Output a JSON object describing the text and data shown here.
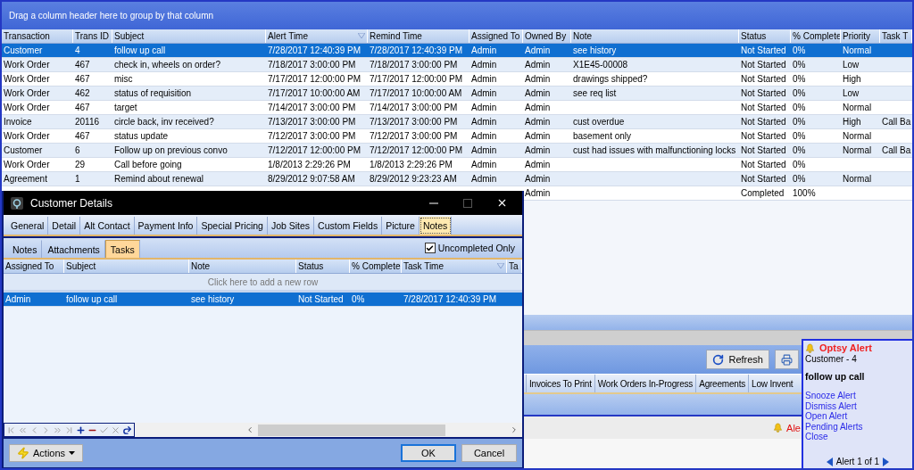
{
  "group_panel": {
    "hint": "Drag a column header here to group by that column"
  },
  "grid": {
    "columns": [
      {
        "label": "Transaction",
        "sorted": false
      },
      {
        "label": "Trans ID",
        "sorted": false
      },
      {
        "label": "Subject",
        "sorted": false
      },
      {
        "label": "Alert Time",
        "sorted": true
      },
      {
        "label": "Remind Time",
        "sorted": false
      },
      {
        "label": "Assigned To",
        "sorted": false
      },
      {
        "label": "Owned By",
        "sorted": false
      },
      {
        "label": "Note",
        "sorted": false
      },
      {
        "label": "Status",
        "sorted": false
      },
      {
        "label": "% Complete",
        "sorted": false
      },
      {
        "label": "Priority",
        "sorted": false
      },
      {
        "label": "Task T",
        "sorted": false
      }
    ],
    "rows": [
      {
        "selected": true,
        "cells": [
          "Customer",
          "4",
          "follow up call",
          "7/28/2017 12:40:39 PM",
          "7/28/2017 12:40:39 PM",
          "Admin",
          "Admin",
          "see history",
          "Not Started",
          "0%",
          "Normal",
          null
        ]
      },
      {
        "selected": false,
        "cells": [
          "Work Order",
          "467",
          "check in, wheels on order?",
          "7/18/2017 3:00:00 PM",
          "7/18/2017 3:00:00 PM",
          "Admin",
          "Admin",
          "X1E45-00008",
          "Not Started",
          "0%",
          "Low",
          null
        ]
      },
      {
        "selected": false,
        "cells": [
          "Work Order",
          "467",
          "misc",
          "7/17/2017 12:00:00 PM",
          "7/17/2017 12:00:00 PM",
          "Admin",
          "Admin",
          "drawings shipped?",
          "Not Started",
          "0%",
          "High",
          null
        ]
      },
      {
        "selected": false,
        "cells": [
          "Work Order",
          "462",
          "status of requisition",
          "7/17/2017 10:00:00 AM",
          "7/17/2017 10:00:00 AM",
          "Admin",
          "Admin",
          "see req list",
          "Not Started",
          "0%",
          "Low",
          null
        ]
      },
      {
        "selected": false,
        "cells": [
          "Work Order",
          "467",
          "target",
          "7/14/2017 3:00:00 PM",
          "7/14/2017 3:00:00 PM",
          "Admin",
          "Admin",
          null,
          "Not Started",
          "0%",
          "Normal",
          null
        ]
      },
      {
        "selected": false,
        "cells": [
          "Invoice",
          "20116",
          "circle back, inv received?",
          "7/13/2017 3:00:00 PM",
          "7/13/2017 3:00:00 PM",
          "Admin",
          "Admin",
          "cust overdue",
          "Not Started",
          "0%",
          "High",
          "Call Ba"
        ]
      },
      {
        "selected": false,
        "cells": [
          "Work Order",
          "467",
          "status update",
          "7/12/2017 3:00:00 PM",
          "7/12/2017 3:00:00 PM",
          "Admin",
          "Admin",
          "basement only",
          "Not Started",
          "0%",
          "Normal",
          null
        ]
      },
      {
        "selected": false,
        "cells": [
          "Customer",
          "6",
          "Follow up on previous convo",
          "7/12/2017 12:00:00 PM",
          "7/12/2017 12:00:00 PM",
          "Admin",
          "Admin",
          "cust had issues with malfunctioning locks",
          "Not Started",
          "0%",
          "Normal",
          "Call Ba"
        ]
      },
      {
        "selected": false,
        "cells": [
          "Work Order",
          "29",
          "Call before going",
          "1/8/2013 2:29:26 PM",
          "1/8/2013 2:29:26 PM",
          "Admin",
          "Admin",
          null,
          "Not Started",
          "0%",
          null,
          null
        ]
      },
      {
        "selected": false,
        "cells": [
          "Agreement",
          "1",
          "Remind about renewal",
          "8/29/2012 9:07:58 AM",
          "8/29/2012 9:23:23 AM",
          "Admin",
          "Admin",
          null,
          "Not Started",
          "0%",
          "Normal",
          null
        ]
      },
      {
        "selected": false,
        "cells": [
          null,
          null,
          null,
          null,
          null,
          null,
          "Admin",
          null,
          "Completed",
          "100%",
          null,
          null
        ]
      }
    ]
  },
  "toolbar": {
    "buttons": [
      {
        "kind": "refresh",
        "label": "Refresh"
      },
      {
        "kind": "print"
      }
    ]
  },
  "module_tabs": [
    {
      "label": "Invoices To Print"
    },
    {
      "label": "Work Orders In-Progress"
    },
    {
      "label": "Agreements"
    },
    {
      "label": "Low Invent"
    }
  ],
  "status_bar": {
    "alert_text": "Ale"
  },
  "dialog": {
    "title": "Customer Details",
    "tabs": [
      {
        "label": "General",
        "selected": false
      },
      {
        "label": "Detail",
        "selected": false
      },
      {
        "label": "Alt Contact",
        "selected": false
      },
      {
        "label": "Payment Info",
        "selected": false
      },
      {
        "label": "Special Pricing",
        "selected": false
      },
      {
        "label": "Job Sites",
        "selected": false
      },
      {
        "label": "Custom Fields",
        "selected": false
      },
      {
        "label": "Picture",
        "selected": false
      },
      {
        "label": "Notes",
        "selected": true
      }
    ],
    "subtabs": [
      {
        "label": "Notes",
        "selected": false
      },
      {
        "label": "Attachments",
        "selected": false
      },
      {
        "label": "Tasks",
        "selected": true
      }
    ],
    "filter": {
      "label": "Uncompleted Only",
      "checked": true
    },
    "grid": {
      "columns": [
        {
          "label": "Assigned To",
          "sorted": false
        },
        {
          "label": "Subject",
          "sorted": false
        },
        {
          "label": "Note",
          "sorted": false
        },
        {
          "label": "Status",
          "sorted": false
        },
        {
          "label": "% Complete",
          "sorted": false
        },
        {
          "label": "Task Time",
          "sorted": true
        },
        {
          "label": "Ta",
          "sorted": false
        }
      ],
      "new_row_hint": "Click here to add a new row",
      "rows": [
        {
          "selected": true,
          "cells": [
            "Admin",
            "follow up call",
            "see history",
            "Not Started",
            "0%",
            "7/28/2017 12:40:39 PM",
            null
          ]
        }
      ]
    },
    "actions_button": "Actions",
    "buttons": [
      "OK",
      "Cancel"
    ]
  },
  "alert_popup": {
    "title": "Optsy Alert",
    "source": "Customer - 4",
    "subject": "follow up call",
    "links": [
      "Snooze Alert",
      "Dismiss Alert",
      "Open Alert",
      "Pending Alerts",
      "Close"
    ],
    "pager": "Alert 1 of 1"
  }
}
